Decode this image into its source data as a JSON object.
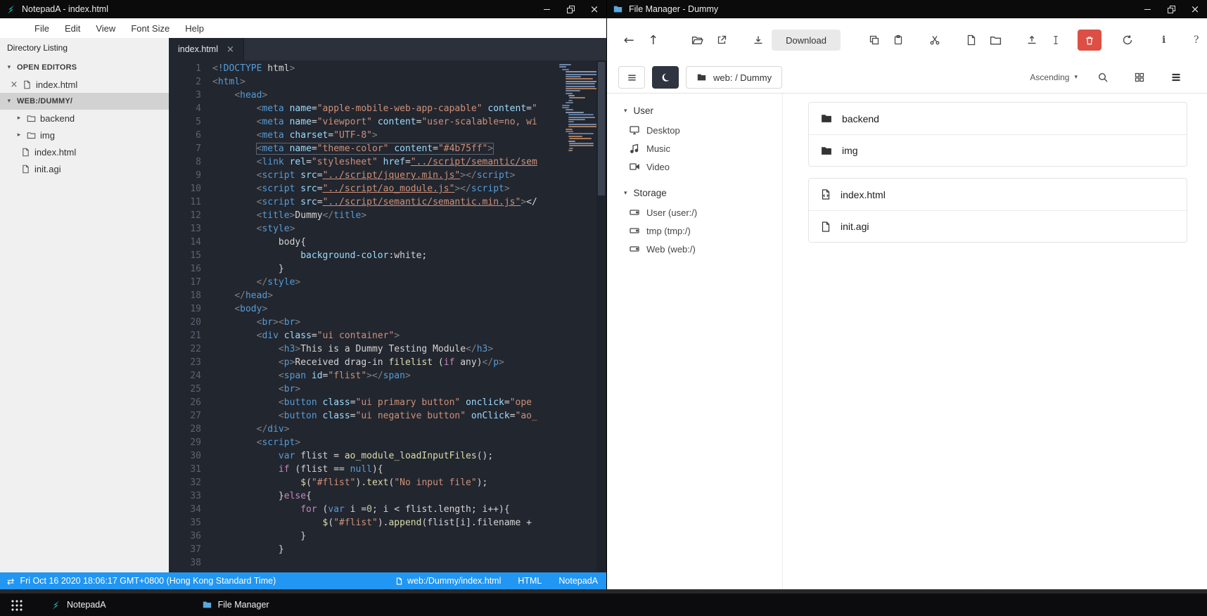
{
  "notepad": {
    "window_title": "NotepadA - index.html",
    "menu": [
      "File",
      "Edit",
      "View",
      "Font Size",
      "Help"
    ],
    "sidebar": {
      "header": "Directory Listing",
      "open_editors_label": "OPEN EDITORS",
      "open_editor_file": "index.html",
      "workspace_label": "WEB:/DUMMY/",
      "entries": [
        {
          "name": "backend",
          "type": "folder"
        },
        {
          "name": "img",
          "type": "folder"
        },
        {
          "name": "index.html",
          "type": "file"
        },
        {
          "name": "init.agi",
          "type": "file"
        }
      ]
    },
    "tab_label": "index.html",
    "boxed_line": 7,
    "code_lines": [
      "<!DOCTYPE html>",
      "<html>",
      "    <head>",
      "        <meta name=\"apple-mobile-web-app-capable\" content=\"",
      "        <meta name=\"viewport\" content=\"user-scalable=no, wi",
      "        <meta charset=\"UTF-8\">",
      "        <meta name=\"theme-color\" content=\"#4b75ff\">",
      "        <link rel=\"stylesheet\" href=\"../script/semantic/sem",
      "        <script src=\"../script/jquery.min.js\"></script>",
      "        <script src=\"../script/ao_module.js\"></script>",
      "        <script src=\"../script/semantic/semantic.min.js\"></",
      "        <title>Dummy</title>",
      "        <style>",
      "            body{",
      "                background-color:white;",
      "            }",
      "        </style>",
      "    </head>",
      "    <body>",
      "        <br><br>",
      "        <div class=\"ui container\">",
      "            <h3>This is a Dummy Testing Module</h3>",
      "            <p>Received drag-in filelist (if any)</p>",
      "            <span id=\"flist\"></span>",
      "            <br>",
      "            <button class=\"ui primary button\" onclick=\"ope",
      "            <button class=\"ui negative button\" onClick=\"ao_",
      "        </div>",
      "        <script>",
      "            var flist = ao_module_loadInputFiles();",
      "            if (flist == null){",
      "                $(\"#flist\").text(\"No input file\");",
      "            }else{",
      "                for (var i =0; i < flist.length; i++){",
      "                    $(\"#flist\").append(flist[i].filename + ",
      "                }",
      "            }",
      ""
    ],
    "statusbar": {
      "datetime": "Fri Oct 16 2020 18:06:17 GMT+0800 (Hong Kong Standard Time)",
      "file_path": "web:/Dummy/index.html",
      "language": "HTML",
      "app_name": "NotepadA"
    }
  },
  "filemanager": {
    "window_title": "File Manager - Dummy",
    "toolbar": {
      "download_label": "Download",
      "icons": [
        "back",
        "up",
        "open-folder",
        "open-external",
        "download",
        "copy",
        "paste",
        "cut",
        "new-file",
        "new-folder",
        "upload",
        "rename",
        "delete",
        "refresh",
        "info",
        "help"
      ]
    },
    "navbar": {
      "icons": [
        "hamburger",
        "dark-mode-moon",
        "search",
        "grid-view",
        "list-view"
      ],
      "path_label": "web: / Dummy",
      "sort_label": "Ascending"
    },
    "sidebar": {
      "groups": [
        {
          "label": "User",
          "items": [
            {
              "name": "Desktop",
              "icon": "desktop"
            },
            {
              "name": "Music",
              "icon": "music"
            },
            {
              "name": "Video",
              "icon": "video"
            }
          ]
        },
        {
          "label": "Storage",
          "items": [
            {
              "name": "User (user:/)",
              "icon": "drive"
            },
            {
              "name": "tmp (tmp:/)",
              "icon": "drive"
            },
            {
              "name": "Web (web:/)",
              "icon": "drive"
            }
          ]
        }
      ]
    },
    "files": [
      {
        "name": "backend",
        "type": "folder"
      },
      {
        "name": "img",
        "type": "folder"
      },
      {
        "name": "index.html",
        "type": "file-code"
      },
      {
        "name": "init.agi",
        "type": "file"
      }
    ]
  },
  "taskbar": {
    "apps": [
      {
        "label": "NotepadA",
        "icon": "notepada-logo"
      },
      {
        "label": "File Manager",
        "icon": "blue-folder"
      }
    ]
  },
  "colors": {
    "statusbar_blue": "#2196f3",
    "titlebar_black": "#0b0b0c",
    "editor_bg": "#22262f",
    "danger_red": "#dd4f44",
    "accent_teal": "#16bcb4",
    "folder_blue": "#5aa7dd",
    "sidebar_gray": "#f0f0f0",
    "selection_gray": "#d2d2d2",
    "syntax": {
      "tag": "#569cd6",
      "attr": "#9cdcfe",
      "string": "#ce9178",
      "keyword_blue": "#569cd6",
      "keyword_purple": "#c586c0",
      "function": "#dcdcaa",
      "number": "#b5cea8",
      "punctuation": "#808080",
      "text": "#d4d4d4"
    }
  }
}
